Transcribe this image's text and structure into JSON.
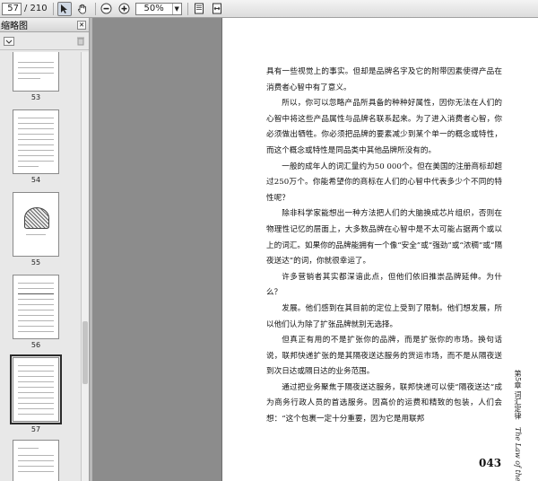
{
  "toolbar": {
    "current_page": "57",
    "total_pages": "/ 210",
    "zoom": "50%",
    "icons": [
      "select-icon",
      "hand-icon",
      "zoom-out-icon",
      "zoom-in-icon",
      "fit-page-icon",
      "fit-width-icon"
    ]
  },
  "sidebar": {
    "title": "缩略图",
    "thumbnails": [
      {
        "label": "53"
      },
      {
        "label": "54"
      },
      {
        "label": "55"
      },
      {
        "label": "56"
      },
      {
        "label": "57",
        "selected": true
      },
      {
        "label": "58"
      }
    ]
  },
  "document": {
    "paragraphs": [
      "具有一些视觉上的事实。但却是品牌名字及它的附带因素使得产品在消费者心智中有了意义。",
      "所以，你可以忽略产品所具备的种种好属性，因你无法在人们的心智中将这些产品属性与品牌名联系起来。为了进入消费者心智，你必须做出牺牲。你必须把品牌的要素减少到某个单一的概念或特性，而这个概念或特性是同品类中其他品牌所没有的。",
      "一般的成年人的词汇量约为50 000个。但在美国的注册商标却超过250万个。你能希望你的商标在人们的心智中代表多少个不同的特性呢？",
      "除非科学家能想出一种方法把人们的大脑换成芯片组织，否则在物理性记忆的层面上，大多数品牌在心智中是不太可能占据两个或以上的词汇。如果你的品牌能拥有一个像“安全”或“强劲”或“浓稠”或“隔夜送达”的词，你就很幸运了。",
      "许多营销者其实都深谙此点，但他们依旧推崇品牌延伸。为什么？",
      "发展。他们感到在其目前的定位上受到了限制。他们想发展，所以他们认为除了扩张品牌就别无选择。",
      "但真正有用的不是扩张你的品牌，而是扩张你的市场。换句话说，联邦快递扩张的是其隔夜送达服务的货运市场，而不是从隔夜送到次日达或隔日达的业务范围。",
      "通过把业务聚焦于隔夜送达服务，联邦快递可以使“隔夜送达”成为商务行政人员的首选服务。因高价的运费和精致的包装，人们会想：“这个包裹一定十分重要，因为它是用联邦"
    ],
    "page_number": "043",
    "running_head": "第5章 词汇定律",
    "running_head_en": "The Law of the Word"
  }
}
